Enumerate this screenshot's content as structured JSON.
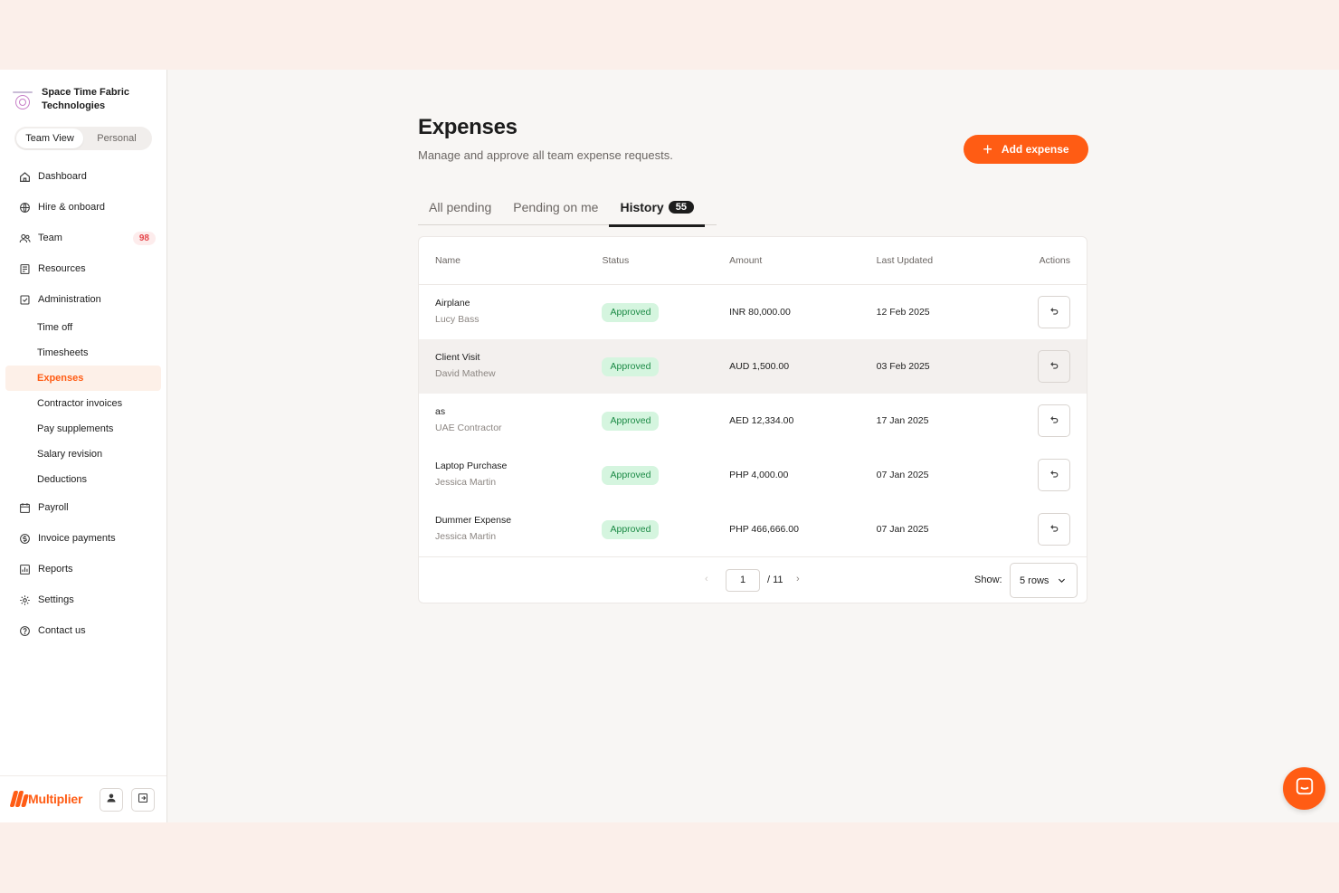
{
  "org": {
    "name": "Space Time Fabric Technologies"
  },
  "view_toggle": {
    "team": "Team View",
    "personal": "Personal"
  },
  "sidebar": {
    "items": [
      {
        "label": "Dashboard",
        "icon": "home-icon"
      },
      {
        "label": "Hire & onboard",
        "icon": "globe-icon"
      },
      {
        "label": "Team",
        "icon": "users-icon",
        "badge": "98"
      },
      {
        "label": "Resources",
        "icon": "book-icon"
      },
      {
        "label": "Administration",
        "icon": "clipboard-check-icon"
      }
    ],
    "admin_sub": [
      "Time off",
      "Timesheets",
      "Expenses",
      "Contractor invoices",
      "Pay supplements",
      "Salary revision",
      "Deductions"
    ],
    "items_after": [
      {
        "label": "Payroll",
        "icon": "calendar-icon"
      },
      {
        "label": "Invoice payments",
        "icon": "dollar-circle-icon"
      },
      {
        "label": "Reports",
        "icon": "chart-icon"
      },
      {
        "label": "Settings",
        "icon": "gear-icon"
      },
      {
        "label": "Contact us",
        "icon": "help-circle-icon"
      }
    ],
    "active_sub": "Expenses",
    "footer": {
      "brand": "Multiplier"
    }
  },
  "header": {
    "title": "Expenses",
    "subtitle": "Manage and approve all team expense requests.",
    "add_button": "Add expense"
  },
  "tabs": [
    {
      "label": "All pending"
    },
    {
      "label": "Pending on me"
    },
    {
      "label": "History",
      "count": "55",
      "active": true
    }
  ],
  "table": {
    "columns": [
      "Name",
      "Status",
      "Amount",
      "Last Updated",
      "Actions"
    ],
    "rows": [
      {
        "name": "Airplane",
        "submitter": "Lucy Bass",
        "status": "Approved",
        "amount": "INR 80,000.00",
        "updated": "12 Feb 2025"
      },
      {
        "name": "Client Visit",
        "submitter": "David Mathew",
        "status": "Approved",
        "amount": "AUD 1,500.00",
        "updated": "03 Feb 2025"
      },
      {
        "name": "as",
        "submitter": "UAE Contractor",
        "status": "Approved",
        "amount": "AED 12,334.00",
        "updated": "17 Jan 2025"
      },
      {
        "name": "Laptop Purchase",
        "submitter": "Jessica Martin",
        "status": "Approved",
        "amount": "PHP 4,000.00",
        "updated": "07 Jan 2025"
      },
      {
        "name": "Dummer Expense",
        "submitter": "Jessica Martin",
        "status": "Approved",
        "amount": "PHP 466,666.00",
        "updated": "07 Jan 2025"
      }
    ]
  },
  "pagination": {
    "page": "1",
    "total": "/ 11",
    "show_label": "Show:",
    "rows_option": "5 rows"
  },
  "colors": {
    "accent": "#ff5c14",
    "approved_bg": "#d5f5df",
    "approved_text": "#1b8a45"
  }
}
